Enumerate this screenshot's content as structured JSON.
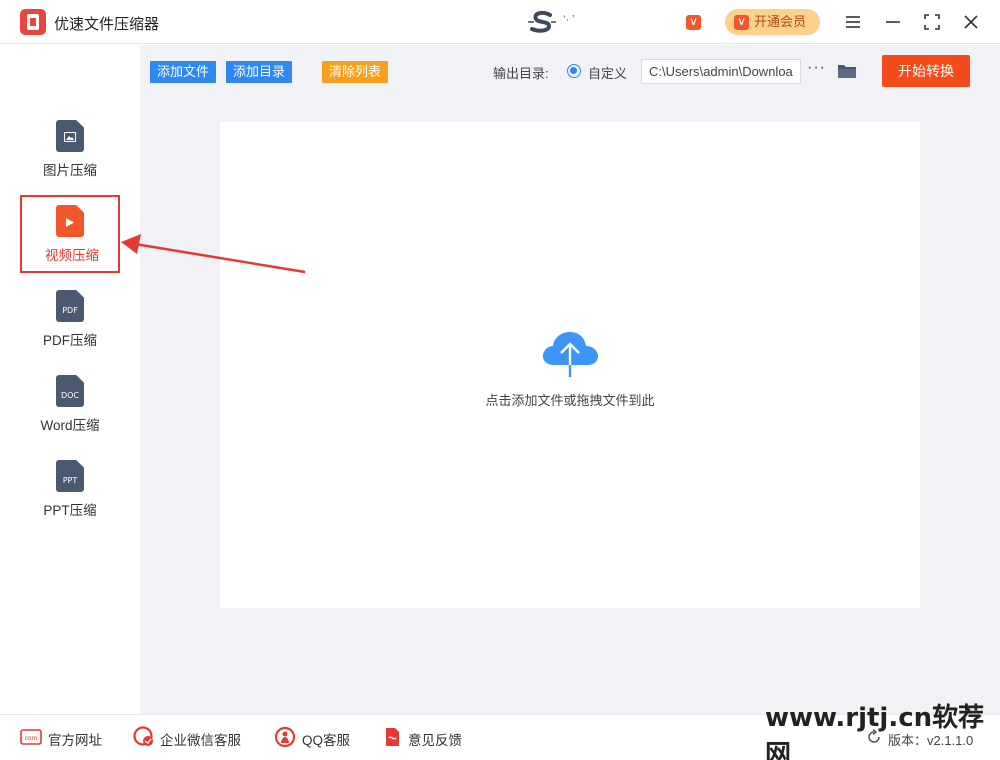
{
  "app": {
    "title": "优速文件压缩器",
    "user_name": "’· ʼ"
  },
  "titlebar": {
    "vip_label": "开通会员",
    "vip_icon_text": "V"
  },
  "sidebar": {
    "items": [
      {
        "label": "图片压缩",
        "icon": "image-file-icon",
        "doc_text": ""
      },
      {
        "label": "视频压缩",
        "icon": "video-file-icon",
        "doc_text": ""
      },
      {
        "label": "PDF压缩",
        "icon": "pdf-file-icon",
        "doc_text": "PDF"
      },
      {
        "label": "Word压缩",
        "icon": "doc-file-icon",
        "doc_text": "DOC"
      },
      {
        "label": "PPT压缩",
        "icon": "ppt-file-icon",
        "doc_text": "PPT"
      }
    ],
    "active_index": 1
  },
  "toolbar": {
    "add_file": "添加文件",
    "add_folder": "添加目录",
    "clear_list": "清除列表",
    "output_label": "输出目录:",
    "radio_label": "自定义",
    "output_path": "C:\\Users\\admin\\Downloads",
    "more": "···",
    "start": "开始转换"
  },
  "dropzone": {
    "hint": "点击添加文件或拖拽文件到此"
  },
  "footer": {
    "website": "官方网址",
    "wechat": "企业微信客服",
    "qq": "QQ客服",
    "feedback": "意见反馈",
    "version": "版本：v2.1.1.0",
    "watermark": "www.rjtj.cn软荐网"
  },
  "colors": {
    "accent": "#2d89ef",
    "danger": "#f34b1b",
    "orange": "#f7a01f",
    "vip": "#fcd28b"
  }
}
